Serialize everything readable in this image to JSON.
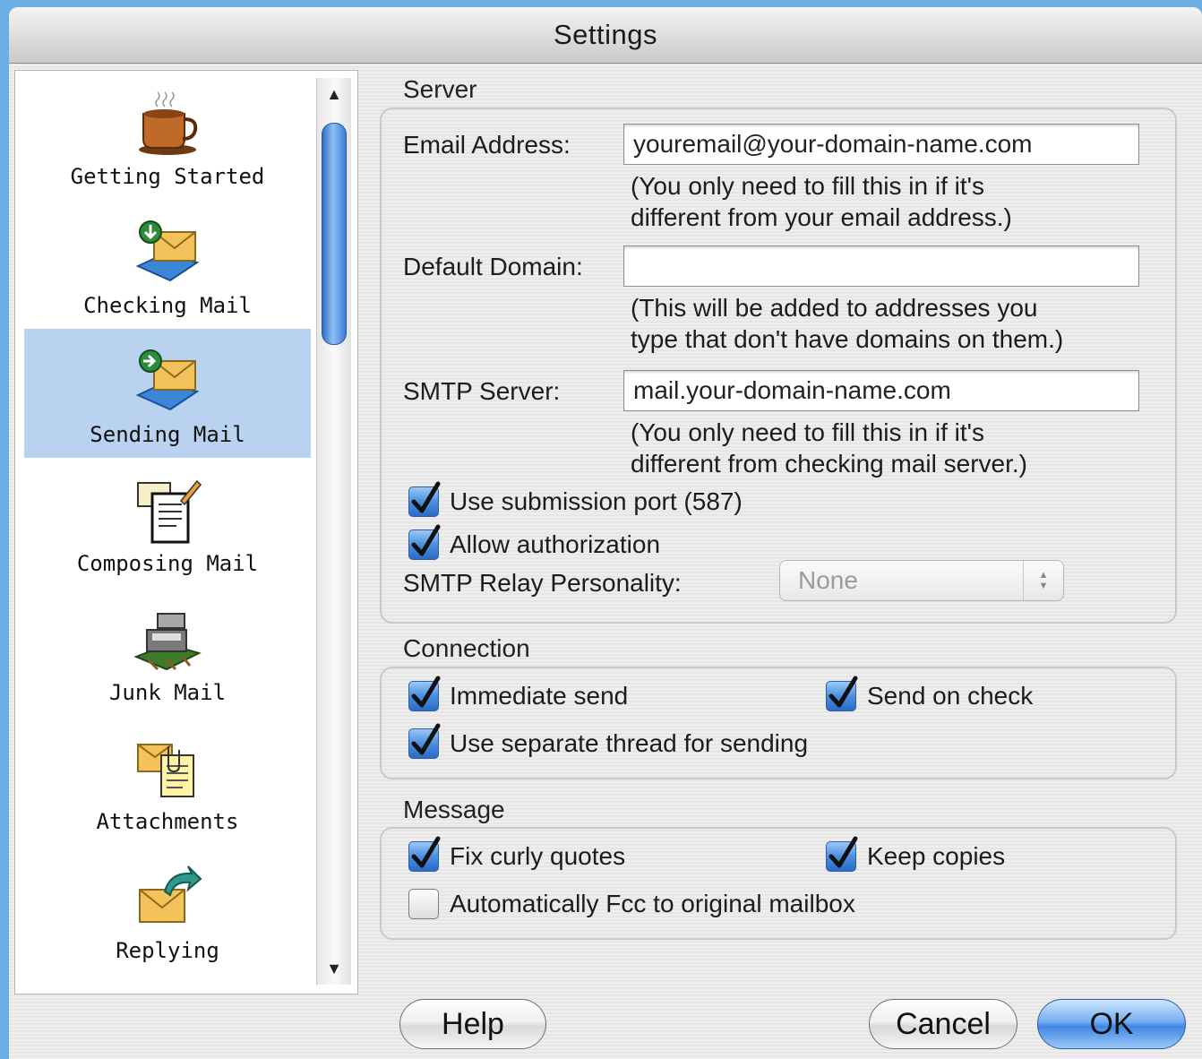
{
  "window": {
    "title": "Settings"
  },
  "sidebar": {
    "items": [
      {
        "label": "Getting Started",
        "icon": "coffee-cup-icon"
      },
      {
        "label": "Checking Mail",
        "icon": "mail-download-icon"
      },
      {
        "label": "Sending Mail",
        "icon": "mail-send-icon",
        "selected": true
      },
      {
        "label": "Composing Mail",
        "icon": "compose-document-icon"
      },
      {
        "label": "Junk Mail",
        "icon": "junk-mail-icon"
      },
      {
        "label": "Attachments",
        "icon": "attachment-documents-icon"
      },
      {
        "label": "Replying",
        "icon": "reply-envelope-icon"
      }
    ]
  },
  "server": {
    "group_label": "Server",
    "email_label": "Email Address:",
    "email_value": "youremail@your-domain-name.com",
    "email_hint_1": "(You only need to fill this in if it's",
    "email_hint_2": "different from your email address.)",
    "domain_label": "Default Domain:",
    "domain_value": "",
    "domain_hint_1": "(This will be added to addresses you",
    "domain_hint_2": "type that don't have domains on them.)",
    "smtp_label": "SMTP Server:",
    "smtp_value": "mail.your-domain-name.com",
    "smtp_hint_1": "(You only need to fill this in if it's",
    "smtp_hint_2": "different from checking mail server.)",
    "submission_port_label": "Use submission port (587)",
    "submission_port_checked": true,
    "allow_auth_label": "Allow authorization",
    "allow_auth_checked": true,
    "relay_label": "SMTP Relay Personality:",
    "relay_value": "None"
  },
  "connection": {
    "group_label": "Connection",
    "immediate_send_label": "Immediate send",
    "immediate_send_checked": true,
    "send_on_check_label": "Send on check",
    "send_on_check_checked": true,
    "separate_thread_label": "Use separate thread for sending",
    "separate_thread_checked": true
  },
  "message": {
    "group_label": "Message",
    "curly_quotes_label": "Fix curly quotes",
    "curly_quotes_checked": true,
    "keep_copies_label": "Keep copies",
    "keep_copies_checked": true,
    "auto_fcc_label": "Automatically Fcc to original mailbox",
    "auto_fcc_checked": false
  },
  "buttons": {
    "help": "Help",
    "cancel": "Cancel",
    "ok": "OK"
  },
  "colors": {
    "accent": "#3f86e3",
    "selection": "#b9d2ef",
    "desktop": "#6aaee6"
  }
}
